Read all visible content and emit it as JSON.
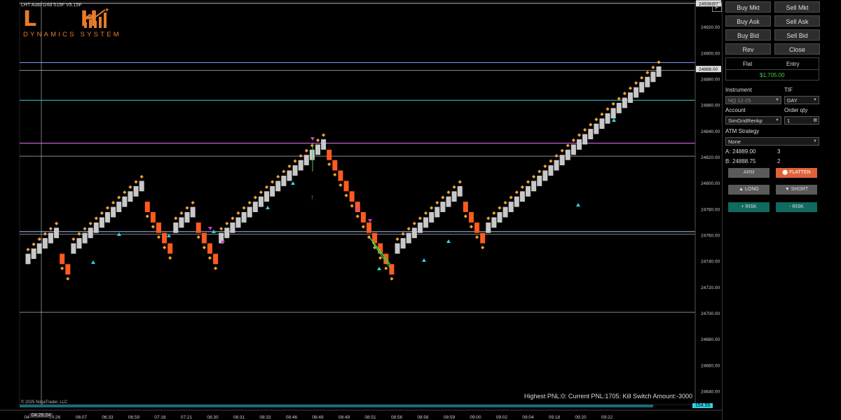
{
  "chart": {
    "title": "LHT Auto Grid 515F V5.15F",
    "logo_letters": "L H",
    "logo_sub": "DYNAMICS SYSTEM",
    "f_button": "F",
    "pnl_readout": "Highest PNL:0: Current PNL:1705: Kill Switch Amount:-3000",
    "copyright": "© 2025 NinjaTrader, LLC",
    "cursor_time": "04:26:24",
    "volume_value": "154.55",
    "price_axis": {
      "labels": [
        "24920.00",
        "24900.00",
        "24880.00",
        "24860.00",
        "24840.00",
        "24820.00",
        "24800.00",
        "24780.00",
        "24760.00",
        "24740.00",
        "24720.00",
        "24700.00",
        "24680.00",
        "24660.00",
        "24640.00"
      ],
      "current_price_tag": "24888.00",
      "top_tag": "24938.50"
    },
    "time_axis": {
      "labels": [
        "04",
        "04:26",
        "06:07",
        "06:33",
        "06:59",
        "07:16",
        "07:21",
        "08:30",
        "08:31",
        "08:33",
        "08:46",
        "08:49",
        "08:49",
        "08:51",
        "08:56",
        "08:56",
        "08:59",
        "09:00",
        "09:02",
        "09:04",
        "09:18",
        "09:20",
        "09:22"
      ]
    },
    "colors": {
      "up": "#c8c8c8",
      "down": "#ff5a1f",
      "marker": "#f0a030",
      "triangle": "#2fd3e0",
      "magenta": "#d040d0",
      "blue_arrow": "#4a9be8"
    }
  },
  "chart_data": {
    "type": "renko",
    "ylim": [
      24630,
      24940
    ],
    "bricks": [
      [
        24738,
        24746,
        "up"
      ],
      [
        24742,
        24750,
        "up"
      ],
      [
        24746,
        24754,
        "up"
      ],
      [
        24750,
        24758,
        "up"
      ],
      [
        24754,
        24762,
        "up"
      ],
      [
        24758,
        24766,
        "up"
      ],
      [
        24738,
        24746,
        "down"
      ],
      [
        24730,
        24738,
        "down"
      ],
      [
        24746,
        24754,
        "up"
      ],
      [
        24750,
        24758,
        "up"
      ],
      [
        24754,
        24762,
        "up"
      ],
      [
        24758,
        24766,
        "up"
      ],
      [
        24762,
        24770,
        "up"
      ],
      [
        24766,
        24774,
        "up"
      ],
      [
        24770,
        24778,
        "up"
      ],
      [
        24774,
        24782,
        "up"
      ],
      [
        24778,
        24786,
        "up"
      ],
      [
        24782,
        24790,
        "up"
      ],
      [
        24786,
        24794,
        "up"
      ],
      [
        24790,
        24798,
        "up"
      ],
      [
        24794,
        24802,
        "up"
      ],
      [
        24778,
        24786,
        "down"
      ],
      [
        24770,
        24778,
        "down"
      ],
      [
        24762,
        24770,
        "down"
      ],
      [
        24754,
        24762,
        "down"
      ],
      [
        24746,
        24754,
        "down"
      ],
      [
        24762,
        24770,
        "up"
      ],
      [
        24766,
        24774,
        "up"
      ],
      [
        24770,
        24778,
        "up"
      ],
      [
        24774,
        24782,
        "up"
      ],
      [
        24762,
        24770,
        "down"
      ],
      [
        24754,
        24762,
        "down"
      ],
      [
        24746,
        24754,
        "down"
      ],
      [
        24738,
        24746,
        "down"
      ],
      [
        24754,
        24762,
        "up"
      ],
      [
        24758,
        24766,
        "up"
      ],
      [
        24762,
        24770,
        "up"
      ],
      [
        24766,
        24774,
        "up"
      ],
      [
        24770,
        24778,
        "up"
      ],
      [
        24774,
        24782,
        "up"
      ],
      [
        24778,
        24786,
        "up"
      ],
      [
        24782,
        24790,
        "up"
      ],
      [
        24786,
        24794,
        "up"
      ],
      [
        24790,
        24798,
        "up"
      ],
      [
        24794,
        24802,
        "up"
      ],
      [
        24798,
        24806,
        "up"
      ],
      [
        24802,
        24810,
        "up"
      ],
      [
        24806,
        24814,
        "up"
      ],
      [
        24810,
        24818,
        "up"
      ],
      [
        24814,
        24822,
        "up"
      ],
      [
        24818,
        24826,
        "up"
      ],
      [
        24822,
        24830,
        "up"
      ],
      [
        24826,
        24834,
        "up"
      ],
      [
        24818,
        24826,
        "down"
      ],
      [
        24810,
        24818,
        "down"
      ],
      [
        24802,
        24810,
        "down"
      ],
      [
        24794,
        24802,
        "down"
      ],
      [
        24786,
        24794,
        "down"
      ],
      [
        24778,
        24786,
        "down"
      ],
      [
        24770,
        24778,
        "down"
      ],
      [
        24762,
        24770,
        "down"
      ],
      [
        24754,
        24762,
        "down"
      ],
      [
        24746,
        24754,
        "down"
      ],
      [
        24738,
        24746,
        "down"
      ],
      [
        24730,
        24738,
        "down"
      ],
      [
        24746,
        24754,
        "up"
      ],
      [
        24750,
        24758,
        "up"
      ],
      [
        24754,
        24762,
        "up"
      ],
      [
        24758,
        24766,
        "up"
      ],
      [
        24762,
        24770,
        "up"
      ],
      [
        24766,
        24774,
        "up"
      ],
      [
        24770,
        24778,
        "up"
      ],
      [
        24774,
        24782,
        "up"
      ],
      [
        24778,
        24786,
        "up"
      ],
      [
        24782,
        24790,
        "up"
      ],
      [
        24786,
        24794,
        "up"
      ],
      [
        24790,
        24798,
        "up"
      ],
      [
        24778,
        24786,
        "down"
      ],
      [
        24770,
        24778,
        "down"
      ],
      [
        24762,
        24770,
        "down"
      ],
      [
        24754,
        24762,
        "down"
      ],
      [
        24762,
        24770,
        "up"
      ],
      [
        24766,
        24774,
        "up"
      ],
      [
        24770,
        24778,
        "up"
      ],
      [
        24774,
        24782,
        "up"
      ],
      [
        24778,
        24786,
        "up"
      ],
      [
        24782,
        24790,
        "up"
      ],
      [
        24786,
        24794,
        "up"
      ],
      [
        24790,
        24798,
        "up"
      ],
      [
        24794,
        24802,
        "up"
      ],
      [
        24798,
        24806,
        "up"
      ],
      [
        24802,
        24810,
        "up"
      ],
      [
        24806,
        24814,
        "up"
      ],
      [
        24810,
        24818,
        "up"
      ],
      [
        24814,
        24822,
        "up"
      ],
      [
        24818,
        24826,
        "up"
      ],
      [
        24822,
        24830,
        "up"
      ],
      [
        24826,
        24834,
        "up"
      ],
      [
        24830,
        24838,
        "up"
      ],
      [
        24834,
        24842,
        "up"
      ],
      [
        24838,
        24846,
        "up"
      ],
      [
        24842,
        24850,
        "up"
      ],
      [
        24846,
        24854,
        "up"
      ],
      [
        24850,
        24858,
        "up"
      ],
      [
        24854,
        24862,
        "up"
      ],
      [
        24858,
        24866,
        "up"
      ],
      [
        24862,
        24870,
        "up"
      ],
      [
        24866,
        24874,
        "up"
      ],
      [
        24870,
        24878,
        "up"
      ],
      [
        24874,
        24882,
        "up"
      ],
      [
        24878,
        24886,
        "up"
      ],
      [
        24882,
        24890,
        "up"
      ]
    ],
    "hlines": [
      {
        "price": 24938.5,
        "color": "#bbbbbb"
      },
      {
        "price": 24893,
        "color": "#8ea0ff"
      },
      {
        "price": 24887,
        "color": "#888888"
      },
      {
        "price": 24864,
        "color": "#2fd3e0"
      },
      {
        "price": 24831,
        "color": "#e070f0"
      },
      {
        "price": 24821,
        "color": "#888888"
      },
      {
        "price": 24763,
        "color": "#a8c8ff"
      },
      {
        "price": 24761,
        "color": "#888888"
      },
      {
        "price": 24701,
        "color": "#888888"
      }
    ]
  },
  "side": {
    "buttons": [
      {
        "label": "Buy Mkt",
        "col": 0,
        "row": 0
      },
      {
        "label": "Sell Mkt",
        "col": 1,
        "row": 0
      },
      {
        "label": "Buy Ask",
        "col": 0,
        "row": 1
      },
      {
        "label": "Sell Ask",
        "col": 1,
        "row": 1
      },
      {
        "label": "Buy Bid",
        "col": 0,
        "row": 2
      },
      {
        "label": "Sell Bid",
        "col": 1,
        "row": 2
      },
      {
        "label": "Rev",
        "col": 0,
        "row": 3
      },
      {
        "label": "Close",
        "col": 1,
        "row": 3
      }
    ],
    "position_flat": "Flat",
    "position_entry": "Entry",
    "position_pnl": "$1,705.00",
    "instrument_label": "Instrument",
    "instrument_value": "NQ 12-25",
    "tif_label": "TIF",
    "tif_value": "DAY",
    "account_label": "Account",
    "account_value": "SimGridRenkp",
    "qty_label": "Order qty",
    "qty_value": "1",
    "atm_label": "ATM Strategy",
    "atm_value": "None",
    "ask_label": "A:",
    "ask_price": "24889.00",
    "ask_size": "3",
    "bid_label": "B:",
    "bid_price": "24888.75",
    "bid_size": "2",
    "arm": "ARM",
    "flatten": "FLATTEN",
    "long": "LONG",
    "short": "SHORT",
    "plus_risk": "+ RISK",
    "minus_risk": "- RISK"
  }
}
